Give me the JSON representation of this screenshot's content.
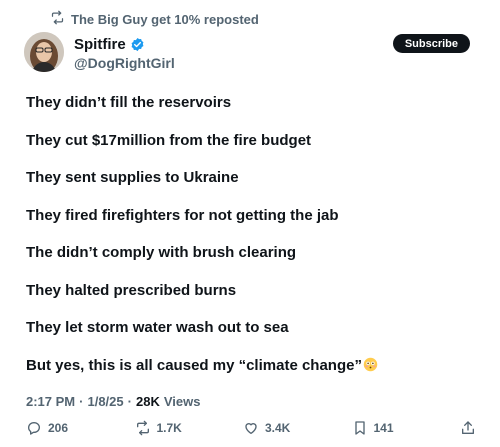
{
  "repost_banner": {
    "text": "The Big Guy get 10% reposted",
    "icon": "repost-icon"
  },
  "author": {
    "display_name": "Spitfire",
    "handle": "@DogRightGirl",
    "verified": true,
    "verified_color": "#1d9bf0"
  },
  "subscribe_label": "Subscribe",
  "post_lines": [
    "They didn’t fill the reservoirs",
    "They cut $17million from the fire budget",
    "They sent supplies to Ukraine",
    "They fired firefighters for not getting the jab",
    "The didn’t comply with brush clearing",
    "They halted prescribed burns",
    "They let storm water wash out to sea",
    "But yes, this is all caused my “climate change”"
  ],
  "post_emoji": "flushed-face-emoji",
  "meta": {
    "time": "2:17 PM",
    "separator": "·",
    "date": "1/8/25",
    "views_count": "28K",
    "views_label": "Views"
  },
  "actions": {
    "replies": "206",
    "reposts": "1.7K",
    "likes": "3.4K",
    "bookmarks": "141"
  },
  "colors": {
    "text": "#0f1419",
    "secondary": "#536471",
    "accent": "#1d9bf0"
  }
}
